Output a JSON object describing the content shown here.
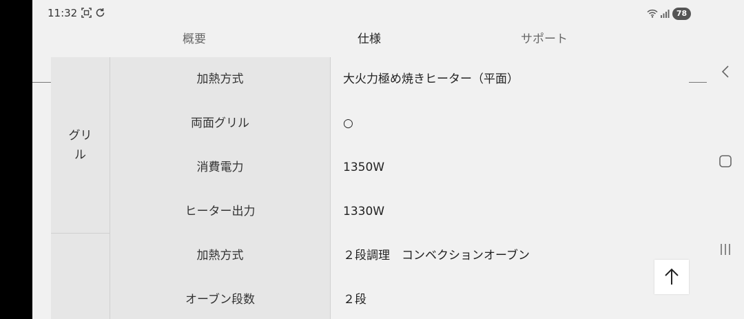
{
  "status": {
    "time": "11:32",
    "battery": "78",
    "icons": [
      "screenshot-icon",
      "sync-icon",
      "wifi-icon",
      "signal-icon"
    ]
  },
  "tabs": [
    {
      "label": "概要",
      "active": false
    },
    {
      "label": "仕様",
      "active": true
    },
    {
      "label": "サポート",
      "active": false
    }
  ],
  "groups": [
    {
      "label": "グリ\nル"
    },
    {
      "label": ""
    }
  ],
  "rows": [
    {
      "label": "加熱方式",
      "value": "大火力極め焼きヒーター（平面）"
    },
    {
      "label": "両面グリル",
      "value": "○"
    },
    {
      "label": "消費電力",
      "value": "1350W"
    },
    {
      "label": "ヒーター出力",
      "value": "1330W"
    },
    {
      "label": "加熱方式",
      "value": "２段調理　コンベクションオーブン"
    },
    {
      "label": "オーブン段数",
      "value": "２段"
    }
  ],
  "nav": {
    "icons": [
      "back-icon",
      "home-icon",
      "recents-icon"
    ]
  },
  "scroll_top": {
    "icon": "arrow-up-icon"
  }
}
